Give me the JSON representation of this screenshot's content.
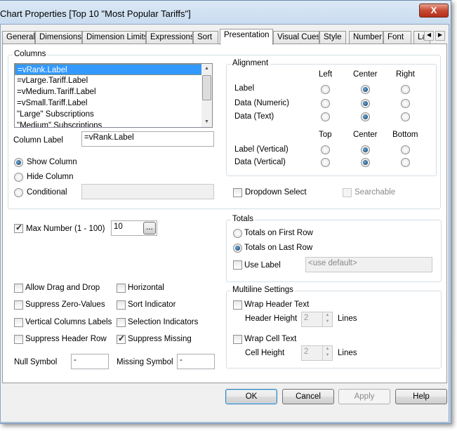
{
  "window": {
    "title": "Chart Properties [Top 10 \"Most Popular Tariffs\"]",
    "close": "X"
  },
  "tabs": [
    "General",
    "Dimensions",
    "Dimension Limits",
    "Expressions",
    "Sort",
    "Presentation",
    "Visual Cues",
    "Style",
    "Number",
    "Font",
    "La"
  ],
  "columns": {
    "label": "Columns",
    "items": [
      "=vRank.Label",
      "=vLarge.Tariff.Label",
      "=vMedium.Tariff.Label",
      "=vSmall.Tariff.Label",
      "\"Large\" Subscriptions",
      "\"Medium\" Subscriptions"
    ],
    "column_label": "Column Label",
    "column_label_value": "=vRank.Label",
    "show": "Show Column",
    "hide": "Hide Column",
    "conditional": "Conditional"
  },
  "alignment": {
    "label": "Alignment",
    "left": "Left",
    "center": "Center",
    "right": "Right",
    "top": "Top",
    "bottom": "Bottom",
    "rows": [
      "Label",
      "Data (Numeric)",
      "Data (Text)"
    ],
    "vrows": [
      "Label (Vertical)",
      "Data (Vertical)"
    ]
  },
  "dropdown_select": "Dropdown Select",
  "searchable": "Searchable",
  "max_number": {
    "label": "Max Number (1 - 100)",
    "value": "10",
    "browse": "..."
  },
  "totals": {
    "label": "Totals",
    "first": "Totals on First Row",
    "last": "Totals on Last Row",
    "use_label": "Use Label",
    "placeholder": "<use default>"
  },
  "options": {
    "drag": "Allow Drag and Drop",
    "zero": "Suppress Zero-Values",
    "vert": "Vertical Columns Labels",
    "header": "Suppress Header Row",
    "horizontal": "Horizontal",
    "sort": "Sort Indicator",
    "sel": "Selection Indicators",
    "missing": "Suppress Missing"
  },
  "null_symbol": {
    "label": "Null Symbol",
    "value": "-"
  },
  "missing_symbol": {
    "label": "Missing Symbol",
    "value": "-"
  },
  "multiline": {
    "label": "Multiline Settings",
    "wrap_header": "Wrap Header Text",
    "header_height": "Header Height",
    "header_value": "2",
    "lines": "Lines",
    "wrap_cell": "Wrap Cell Text",
    "cell_height": "Cell Height",
    "cell_value": "2"
  },
  "buttons": {
    "ok": "OK",
    "cancel": "Cancel",
    "apply": "Apply",
    "help": "Help"
  }
}
